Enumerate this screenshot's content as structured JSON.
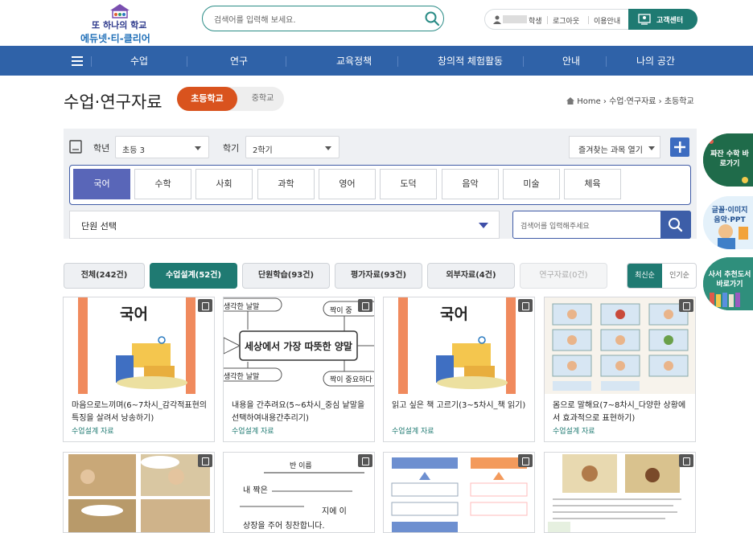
{
  "header": {
    "logo_line1": "또 하나의 학교",
    "logo_line2": "에듀넷·티-클리어",
    "search_placeholder": "검색어를 입력해 보세요.",
    "user_role": "학생",
    "logout": "로그아웃",
    "guide": "이용안내",
    "customer_center": "고객센터"
  },
  "nav": {
    "items": [
      "수업",
      "연구",
      "교육정책",
      "창의적 체험활동",
      "안내",
      "나의 공간"
    ]
  },
  "page": {
    "title": "수업·연구자료",
    "seg_elem": "초등학교",
    "seg_mid": "중학교",
    "crumb_home": "Home",
    "crumb_1": "수업·연구자료",
    "crumb_2": "초등학교"
  },
  "filter": {
    "grade_label": "학년",
    "grade_value": "초등 3",
    "term_label": "학기",
    "term_value": "2학기",
    "fav_label": "즐겨찾는 과목 열기",
    "subjects": [
      "국어",
      "수학",
      "사회",
      "과학",
      "영어",
      "도덕",
      "음악",
      "미술",
      "체육"
    ],
    "unit_label": "단원 선택",
    "unit_search_placeholder": "검색어를 입력해주세요"
  },
  "tabs": [
    {
      "label": "전체(242건)",
      "state": "normal"
    },
    {
      "label": "수업설계(52건)",
      "state": "active"
    },
    {
      "label": "단원학습(93건)",
      "state": "normal"
    },
    {
      "label": "평가자료(93건)",
      "state": "normal"
    },
    {
      "label": "외부자료(4건)",
      "state": "normal"
    },
    {
      "label": "연구자료(0건)",
      "state": "disabled"
    }
  ],
  "sort": {
    "latest": "최신순",
    "popular": "인기순"
  },
  "cards": [
    {
      "title": "마음으로느끼며(6~7차시_감각적표현의특징을 살려서 낭송하기)",
      "tag": "수업설계 자료",
      "thumb_title": "국어"
    },
    {
      "title": "내용을 간추려요(5~6차시_중심 낱말을선택하여내용간추리기)",
      "tag": "수업설계 자료",
      "thumb_title": "세상에서 가장 따뜻한 양말",
      "thumb_bits": [
        "생각한 날말",
        "짝이 중",
        "생각한 날말",
        "짝이 중요하다"
      ]
    },
    {
      "title": "읽고 싶은 책 고르기(3~5차시_책 읽기)",
      "tag": "수업설계 자료",
      "thumb_title": "국어"
    },
    {
      "title": "몸으로 말해요(7~8차시_다양한 상황에서 효과적으로 표현하기)",
      "tag": "수업설계 자료"
    }
  ],
  "row2": {
    "c2_head": "반 이름",
    "c2_lines": [
      "내 짝은",
      "지에 이",
      "상장을 주어 칭찬합니다."
    ]
  },
  "side": {
    "b1": "짜잔 수학 바로가기",
    "b2": "글꼴·이미지 음악·PPT",
    "b3": "사서 추천도서 바로가기"
  },
  "colors": {
    "nav": "#2f62a8",
    "accent_orange": "#d9531e",
    "teal": "#1f7a72",
    "subject_active": "#5966b8"
  }
}
